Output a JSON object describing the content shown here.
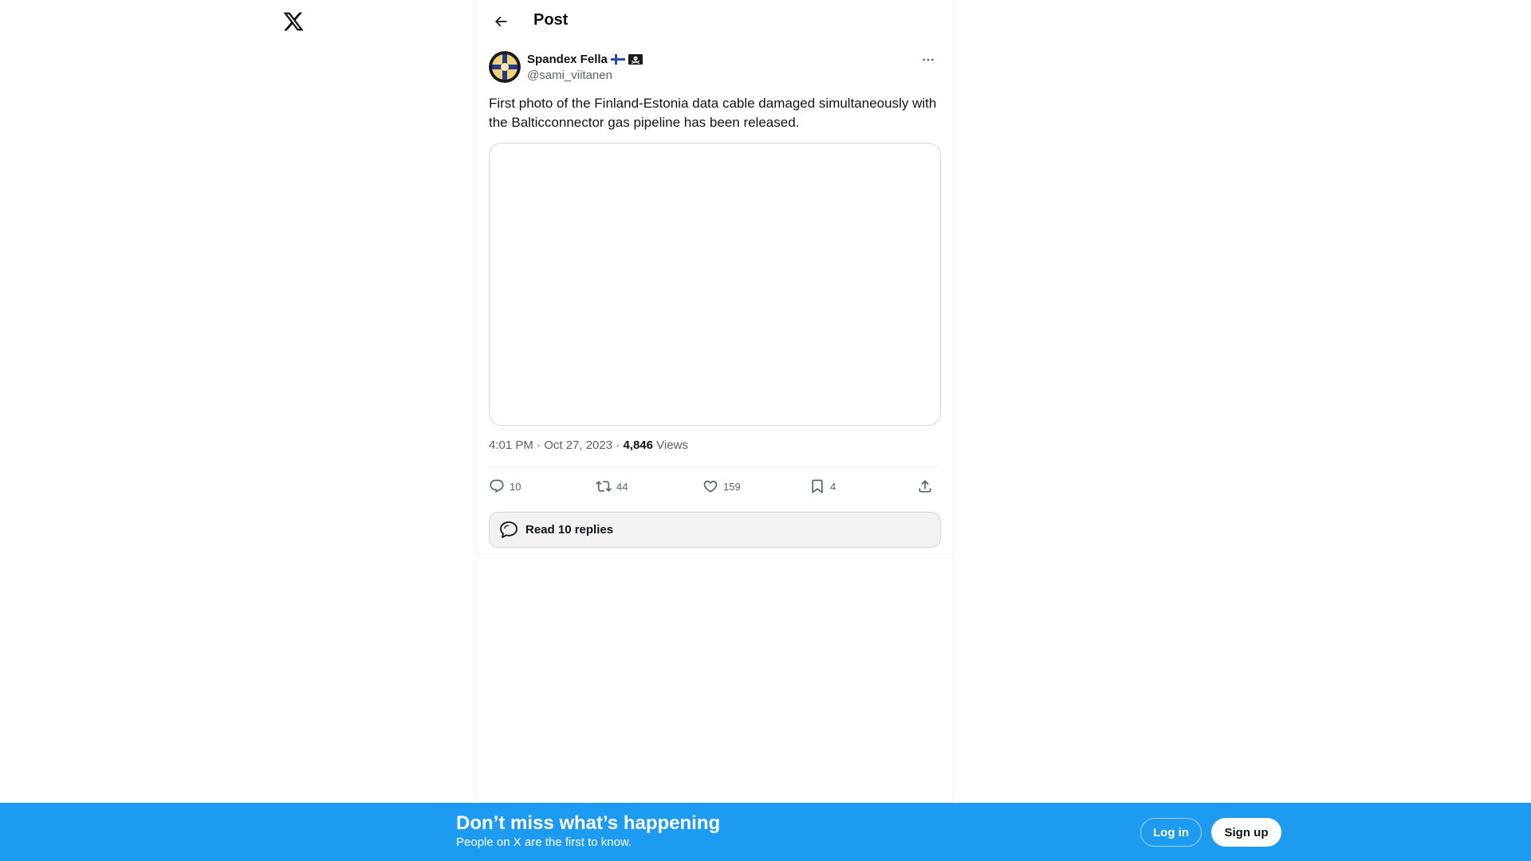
{
  "header": {
    "title": "Post"
  },
  "post": {
    "author": {
      "display_name": "Spandex Fella",
      "handle": "@sami_viitanen",
      "badges": [
        "finland-flag-emoji",
        "pirate-flag-emoji"
      ]
    },
    "text": "First photo of the Finland-Estonia data cable damaged simultaneously with the Balticconnector gas pipeline has been released.",
    "timestamp": "4:01 PM · Oct 27, 2023",
    "separator": " · ",
    "views_count": "4,846",
    "views_label": "Views",
    "actions": {
      "replies": "10",
      "reposts": "44",
      "likes": "159",
      "bookmarks": "4"
    },
    "read_replies_label": "Read 10 replies"
  },
  "banner": {
    "title": "Don’t miss what’s happening",
    "subtitle": "People on X are the first to know.",
    "login_label": "Log in",
    "signup_label": "Sign up"
  },
  "colors": {
    "accent": "#1d9bf0",
    "text_primary": "#0f1419",
    "text_secondary": "#536471",
    "border": "#cfd9de"
  }
}
